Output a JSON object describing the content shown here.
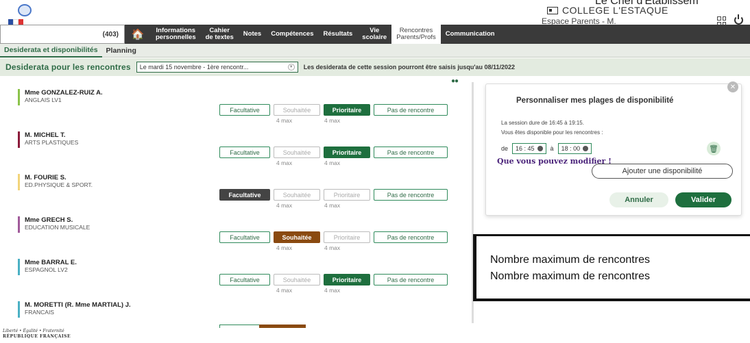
{
  "header": {
    "chef": "Le Chef d'Etablissem",
    "college": "COLLEGE L'ESTAQUE",
    "espace": "Espace Parents - M."
  },
  "nav": {
    "search_count": "(403)",
    "items": [
      {
        "label": "Informations\npersonnelles"
      },
      {
        "label": "Cahier\nde textes"
      },
      {
        "label": "Notes"
      },
      {
        "label": "Compétences"
      },
      {
        "label": "Résultats"
      },
      {
        "label": "Vie\nscolaire"
      },
      {
        "label": "Rencontres\nParents/Profs"
      },
      {
        "label": "Communication"
      }
    ]
  },
  "subtabs": [
    "Desiderata et disponibilités",
    "Planning"
  ],
  "desiderata": {
    "title": "Desiderata pour les rencontres",
    "select_value": "Le mardi 15 novembre - 1ère rencontr...",
    "note": "Les desiderata de cette session pourront être saisis jusqu'au 08/11/2022"
  },
  "buttons": {
    "facultative": "Facultative",
    "souhaitee": "Souhaitée",
    "prioritaire": "Prioritaire",
    "pas": "Pas de rencontre",
    "max": "4 max"
  },
  "teachers": [
    {
      "name": "Mme GONZALEZ-RUIZ A.",
      "subject": "ANGLAIS LV1",
      "color": "#8bc34a",
      "selected": "prioritaire"
    },
    {
      "name": "M. MICHEL T.",
      "subject": "ARTS PLASTIQUES",
      "color": "#8b1a3a",
      "selected": "prioritaire"
    },
    {
      "name": "M. FOURIE S.",
      "subject": "ED.PHYSIQUE & SPORT.",
      "color": "#f2d47a",
      "selected": "facultative"
    },
    {
      "name": "Mme GRECH S.",
      "subject": "EDUCATION MUSICALE",
      "color": "#a05a9a",
      "selected": "souhaitee"
    },
    {
      "name": "Mme BARRAL E.",
      "subject": "ESPAGNOL LV2",
      "color": "#4ab0c4",
      "selected": "prioritaire"
    },
    {
      "name": "M. MORETTI (R. Mme MARTIAL) J.",
      "subject": "FRANCAIS",
      "color": "#4ab0c4",
      "selected": "souhaitee"
    }
  ],
  "panel": {
    "title": "Personnaliser mes plages de disponibilité",
    "duration": "La session dure de 16:45 à 19:15.",
    "dispo": "Vous êtes disponible pour les rencontres :",
    "from_label": "de",
    "from_time": "16 : 45",
    "to_label": "à",
    "to_time": "18 : 00",
    "modifier": "Que vous pouvez modifier !",
    "add": "Ajouter une disponibilité",
    "cancel": "Annuler",
    "validate": "Valider"
  },
  "annotation": {
    "line1": "Nombre maximum de rencontres",
    "line2": "Nombre maximum de rencontres"
  },
  "footer": {
    "motto": "Liberté • Égalité • Fraternité",
    "rep": "RÉPUBLIQUE FRANÇAISE"
  }
}
